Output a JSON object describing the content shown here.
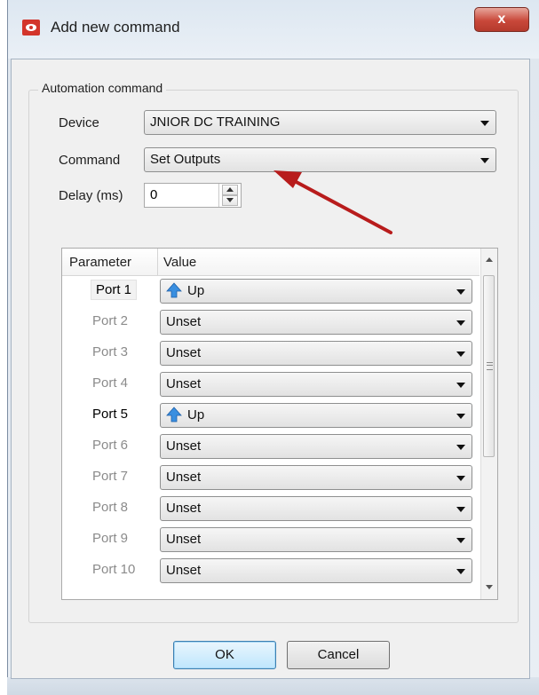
{
  "window": {
    "title": "Add new command",
    "close_label": "x"
  },
  "group": {
    "legend": "Automation command",
    "device_label": "Device",
    "device_value": "JNIOR DC TRAINING",
    "command_label": "Command",
    "command_value": "Set Outputs",
    "delay_label": "Delay (ms)",
    "delay_value": "0"
  },
  "table": {
    "headers": [
      "Parameter",
      "Value"
    ],
    "rows": [
      {
        "port": "Port 1",
        "value": "Up",
        "active": true,
        "selected": true
      },
      {
        "port": "Port 2",
        "value": "Unset",
        "active": false
      },
      {
        "port": "Port 3",
        "value": "Unset",
        "active": false
      },
      {
        "port": "Port 4",
        "value": "Unset",
        "active": false
      },
      {
        "port": "Port 5",
        "value": "Up",
        "active": true
      },
      {
        "port": "Port 6",
        "value": "Unset",
        "active": false
      },
      {
        "port": "Port 7",
        "value": "Unset",
        "active": false
      },
      {
        "port": "Port 8",
        "value": "Unset",
        "active": false
      },
      {
        "port": "Port 9",
        "value": "Unset",
        "active": false
      },
      {
        "port": "Port 10",
        "value": "Unset",
        "active": false
      }
    ]
  },
  "buttons": {
    "ok": "OK",
    "cancel": "Cancel"
  },
  "colors": {
    "annotation_arrow": "#b81c1c",
    "up_arrow": "#3a8fe0",
    "close_button": "#c9483a"
  }
}
